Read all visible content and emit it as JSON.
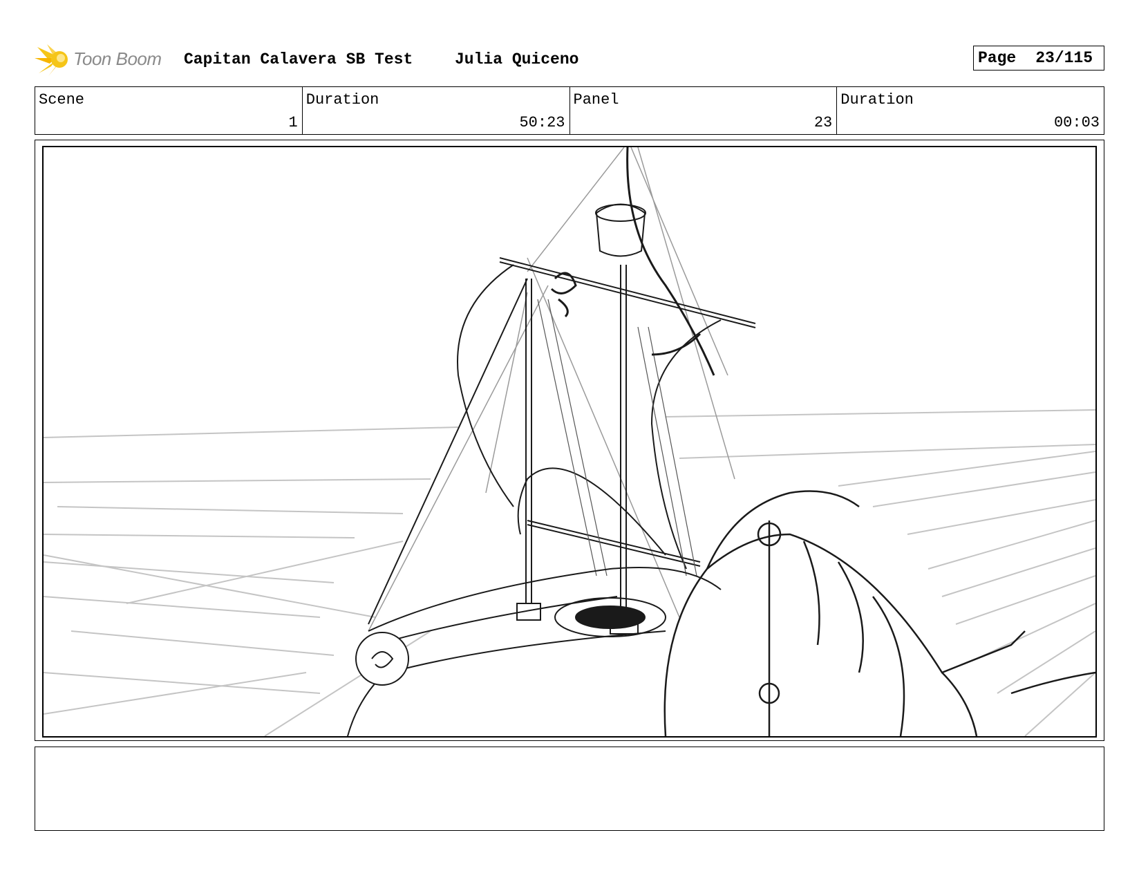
{
  "header": {
    "logo_text": "Toon Boom",
    "project_title": "Capitan Calavera SB Test",
    "author": "Julia Quiceno",
    "page_label": "Page",
    "page_number": "23/115"
  },
  "info": {
    "scene_label": "Scene",
    "scene_value": "1",
    "scene_duration_label": "Duration",
    "scene_duration_value": "50:23",
    "panel_label": "Panel",
    "panel_value": "23",
    "panel_duration_label": "Duration",
    "panel_duration_value": "00:03"
  },
  "colors": {
    "logo_accent": "#f5c518",
    "logo_text": "#8a8a8a",
    "sketch_line": "#1a1a1a",
    "guide_line": "#bdbdbd"
  }
}
